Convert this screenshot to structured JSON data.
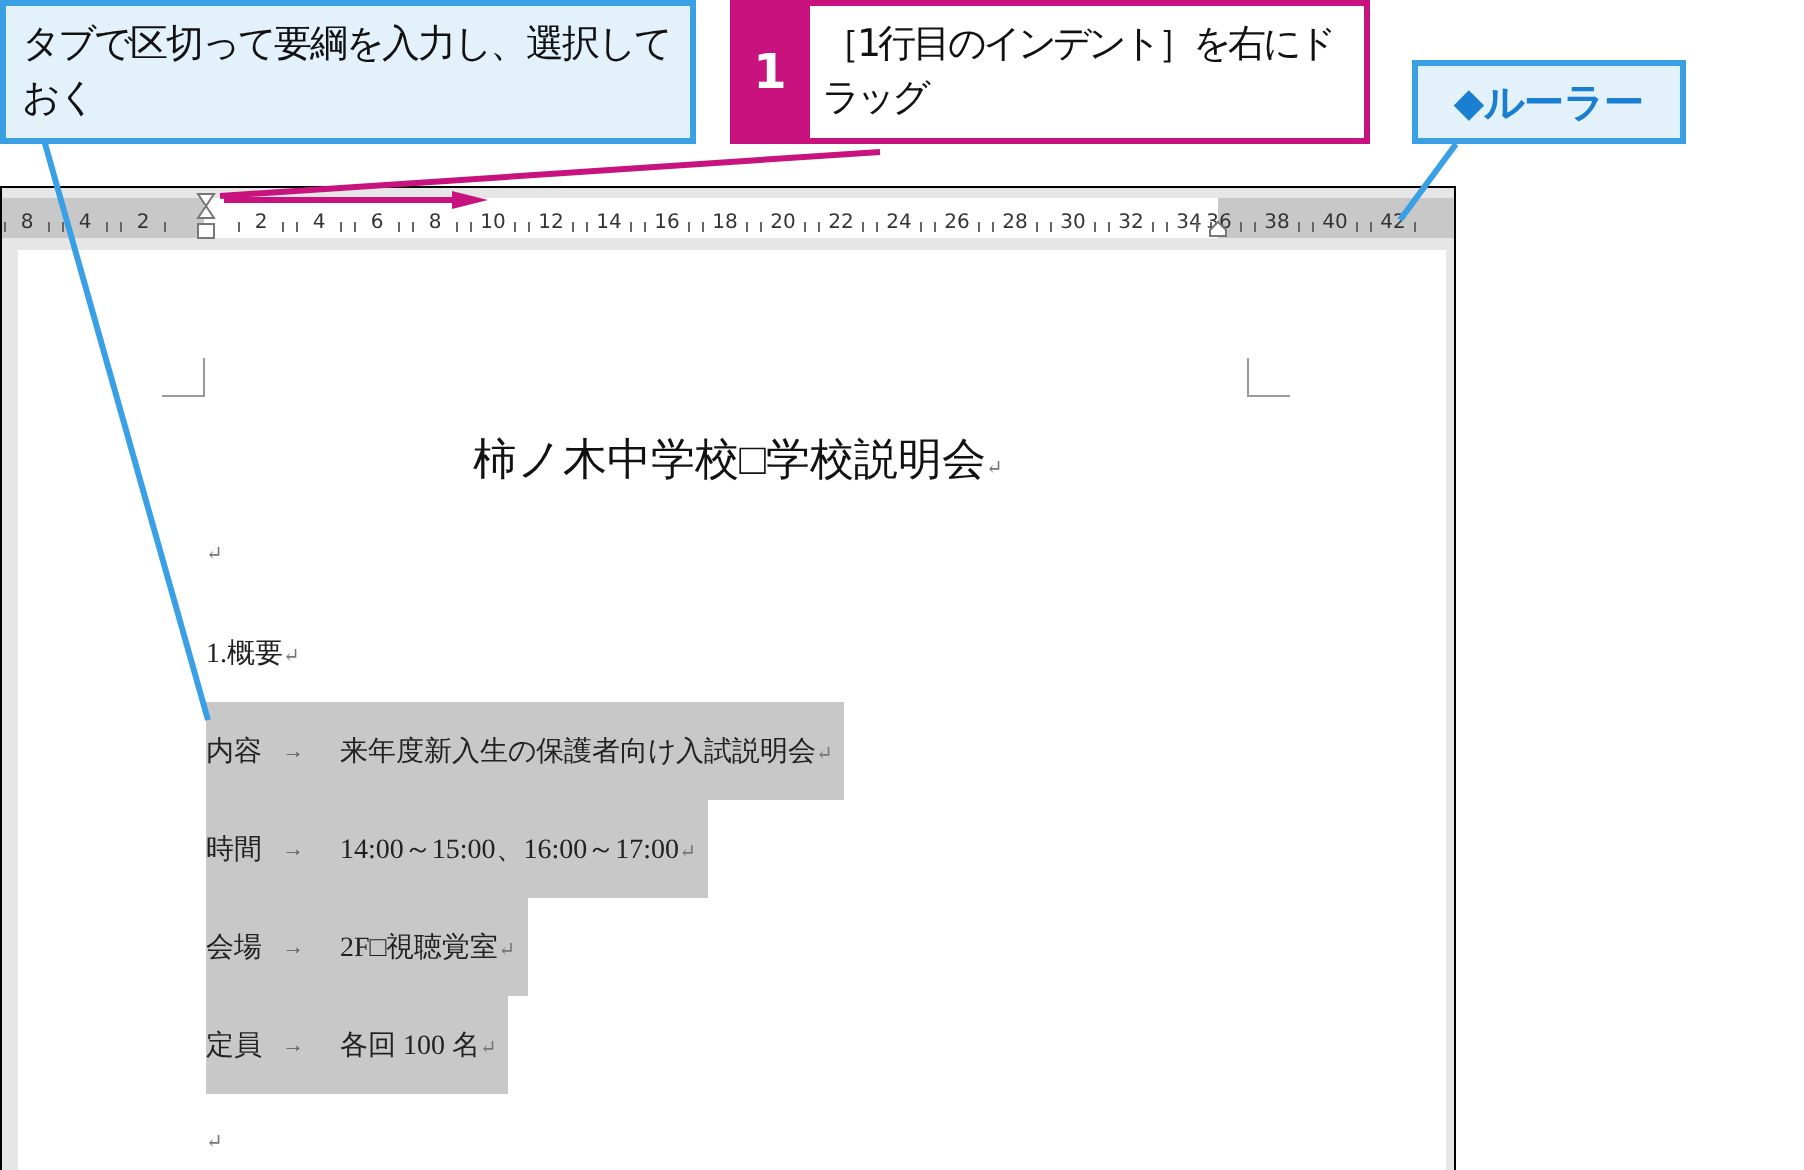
{
  "callouts": [
    {
      "kind": "note",
      "text": "タブで区切って要綱を入力し、選択しておく"
    },
    {
      "kind": "step",
      "number": "1",
      "text": "［1行目のインデント］を右にドラッグ"
    },
    {
      "kind": "label",
      "text": "◆ルーラー"
    }
  ],
  "ruler": {
    "left_labels": [
      "8",
      "4",
      "2"
    ],
    "right_labels": [
      "2",
      "4",
      "6",
      "8",
      "10",
      "12",
      "14",
      "16",
      "18",
      "20",
      "22",
      "24",
      "26",
      "28",
      "30",
      "32",
      "34",
      "36",
      "38",
      "40",
      "42"
    ]
  },
  "document": {
    "title": "柿ノ木中学校□学校説明会",
    "title_mark": "↵",
    "lines": [
      {
        "kind": "blank",
        "mark": "↵"
      },
      {
        "kind": "heading",
        "text": "1.概要",
        "mark": "↵"
      },
      {
        "kind": "item",
        "label": "内容",
        "tab": "→",
        "value": "来年度新入生の保護者向け入試説明会",
        "mark": "↵",
        "selected": true
      },
      {
        "kind": "item",
        "label": "時間",
        "tab": "→",
        "value": "14:00～15:00、16:00～17:00",
        "mark": "↵",
        "selected": true
      },
      {
        "kind": "item",
        "label": "会場",
        "tab": "→",
        "value": "2F□視聴覚室",
        "mark": "↵",
        "selected": true
      },
      {
        "kind": "item",
        "label": "定員",
        "tab": "→",
        "value": "各回 100 名",
        "mark": "↵",
        "selected": true
      },
      {
        "kind": "blank",
        "mark": "↵"
      }
    ]
  }
}
